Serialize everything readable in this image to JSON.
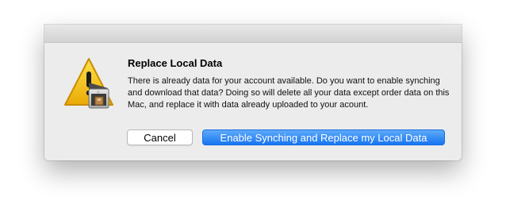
{
  "dialog": {
    "title": "Replace Local Data",
    "message": "There is already data for your account available. Do you want to enable synching and download that data? Doing so will delete all your data except order data on this Mac, and replace it with data already uploaded to your acount.",
    "icon": "warning-store-icon",
    "buttons": {
      "cancel_label": "Cancel",
      "confirm_label": "Enable Synching and Replace my Local Data"
    }
  },
  "colors": {
    "sheet_background": "#ececec",
    "default_button": "#1a7cf4",
    "warning_yellow": "#f5c518"
  }
}
